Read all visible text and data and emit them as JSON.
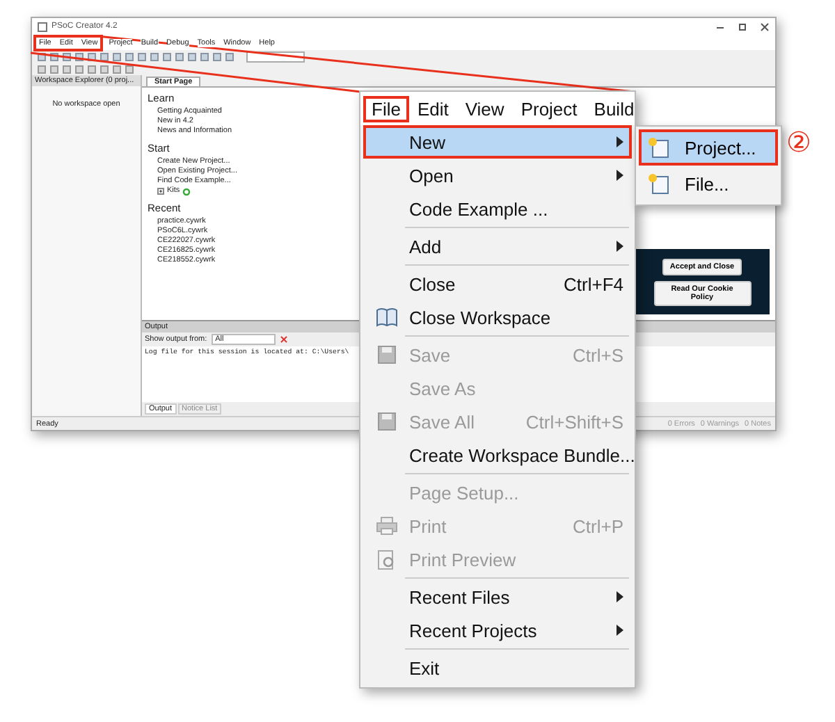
{
  "window": {
    "title": "PSoC Creator 4.2",
    "menu": [
      {
        "label": "File",
        "marked": true
      },
      {
        "label": "Edit",
        "marked": true
      },
      {
        "label": "View",
        "marked": true
      },
      {
        "label": "Project",
        "marked": false
      },
      {
        "label": "Build",
        "marked": false
      },
      {
        "label": "Debug",
        "marked": false
      },
      {
        "label": "Tools",
        "marked": false
      },
      {
        "label": "Window",
        "marked": false
      },
      {
        "label": "Help",
        "marked": false
      }
    ]
  },
  "workspace_explorer": {
    "title": "Workspace Explorer (0 proj...",
    "message": "No workspace open"
  },
  "start_page": {
    "tab": "Start Page",
    "sections": [
      {
        "heading": "Learn",
        "items": [
          {
            "label": "Getting Acquainted",
            "kind": "link"
          },
          {
            "label": "New in 4.2",
            "kind": "link"
          },
          {
            "label": "News and Information",
            "kind": "link"
          }
        ]
      },
      {
        "heading": "Start",
        "items": [
          {
            "label": "Create New Project...",
            "kind": "link"
          },
          {
            "label": "Open Existing Project...",
            "kind": "link"
          },
          {
            "label": "Find Code Example...",
            "kind": "link"
          },
          {
            "label": "Kits",
            "kind": "expandable"
          }
        ]
      },
      {
        "heading": "Recent",
        "items": [
          {
            "label": "practice.cywrk",
            "kind": "link"
          },
          {
            "label": "PSoC6L.cywrk",
            "kind": "link"
          },
          {
            "label": "CE222027.cywrk",
            "kind": "link"
          },
          {
            "label": "CE216825.cywrk",
            "kind": "link"
          },
          {
            "label": "CE218552.cywrk",
            "kind": "link"
          }
        ]
      }
    ]
  },
  "cookie_banner": {
    "buttons": [
      "Accept and Close",
      "Read Our Cookie Policy"
    ]
  },
  "output": {
    "title": "Output",
    "filter_label": "Show output from:",
    "filter_value": "All",
    "log": "Log file for this session is located at: C:\\Users\\",
    "tabs": [
      {
        "label": "Output",
        "selected": true
      },
      {
        "label": "Notice List",
        "selected": false
      }
    ]
  },
  "status_bar": {
    "text": "Ready",
    "counts": [
      "0 Errors",
      "0 Warnings",
      "0 Notes"
    ]
  },
  "zoomed_menu": {
    "menubar": [
      {
        "label": "File",
        "marked": true
      },
      {
        "label": "Edit",
        "marked": false
      },
      {
        "label": "View",
        "marked": false
      },
      {
        "label": "Project",
        "marked": false
      },
      {
        "label": "Build",
        "marked": false
      }
    ],
    "items": [
      {
        "kind": "item",
        "label": "New",
        "submenu": true,
        "selected": true,
        "disabled": false,
        "marked": true
      },
      {
        "kind": "item",
        "label": "Open",
        "submenu": true,
        "selected": false,
        "disabled": false,
        "marked": false
      },
      {
        "kind": "item",
        "label": "Code Example ...",
        "selected": false,
        "disabled": false,
        "marked": false
      },
      {
        "kind": "separator"
      },
      {
        "kind": "item",
        "label": "Add",
        "submenu": true,
        "selected": false,
        "disabled": false,
        "marked": false
      },
      {
        "kind": "separator"
      },
      {
        "kind": "item",
        "label": "Close",
        "shortcut": "Ctrl+F4",
        "selected": false,
        "disabled": false,
        "marked": false
      },
      {
        "kind": "item",
        "label": "Close Workspace",
        "selected": false,
        "disabled": false,
        "marked": false
      },
      {
        "kind": "separator"
      },
      {
        "kind": "item",
        "label": "Save",
        "shortcut": "Ctrl+S",
        "selected": false,
        "disabled": true,
        "marked": false
      },
      {
        "kind": "item",
        "label": "Save As",
        "selected": false,
        "disabled": true,
        "marked": false
      },
      {
        "kind": "item",
        "label": "Save All",
        "shortcut": "Ctrl+Shift+S",
        "selected": false,
        "disabled": true,
        "marked": false
      },
      {
        "kind": "item",
        "label": "Create Workspace Bundle...",
        "selected": false,
        "disabled": false,
        "marked": false
      },
      {
        "kind": "separator"
      },
      {
        "kind": "item",
        "label": "Page Setup...",
        "selected": false,
        "disabled": true,
        "marked": false
      },
      {
        "kind": "item",
        "label": "Print",
        "shortcut": "Ctrl+P",
        "selected": false,
        "disabled": true,
        "marked": false
      },
      {
        "kind": "item",
        "label": "Print Preview",
        "selected": false,
        "disabled": true,
        "marked": false
      },
      {
        "kind": "separator"
      },
      {
        "kind": "item",
        "label": "Recent Files",
        "submenu": true,
        "selected": false,
        "disabled": false,
        "marked": false
      },
      {
        "kind": "item",
        "label": "Recent Projects",
        "submenu": true,
        "selected": false,
        "disabled": false,
        "marked": false
      },
      {
        "kind": "separator"
      },
      {
        "kind": "item",
        "label": "Exit",
        "selected": false,
        "disabled": false,
        "marked": false
      }
    ],
    "submenu": [
      {
        "label": "Project...",
        "selected": true,
        "marked": true
      },
      {
        "label": "File...",
        "selected": false,
        "marked": false
      }
    ]
  },
  "callout": "②"
}
